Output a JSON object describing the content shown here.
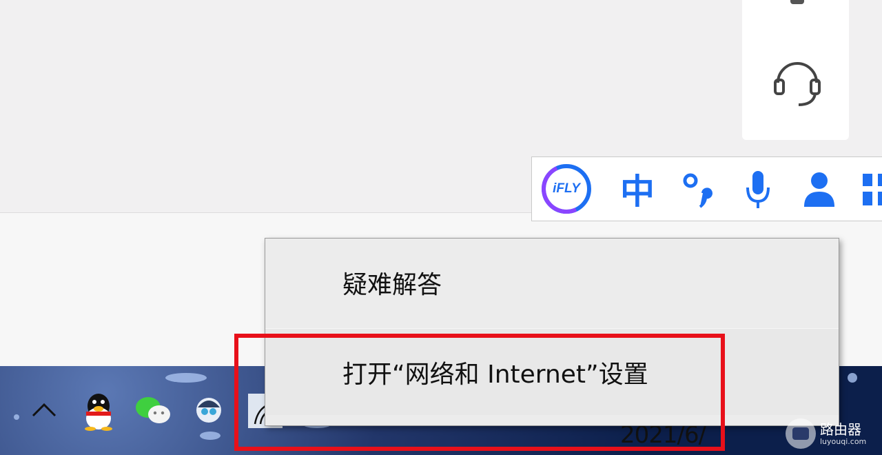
{
  "ime_toolbar": {
    "logo_text": "iFLY",
    "mode_label": "中",
    "accent": "#1d6ff2"
  },
  "context_menu": {
    "items": [
      {
        "label": "疑难解答"
      },
      {
        "label": "打开“网络和 Internet”设置"
      }
    ]
  },
  "taskbar": {
    "clock_partial": "2021/6/"
  },
  "watermark": {
    "title": "路由器",
    "subtitle": "luyouqi.com"
  },
  "colors": {
    "highlight": "#e8101a",
    "taskbar": "#0d1f4c"
  }
}
